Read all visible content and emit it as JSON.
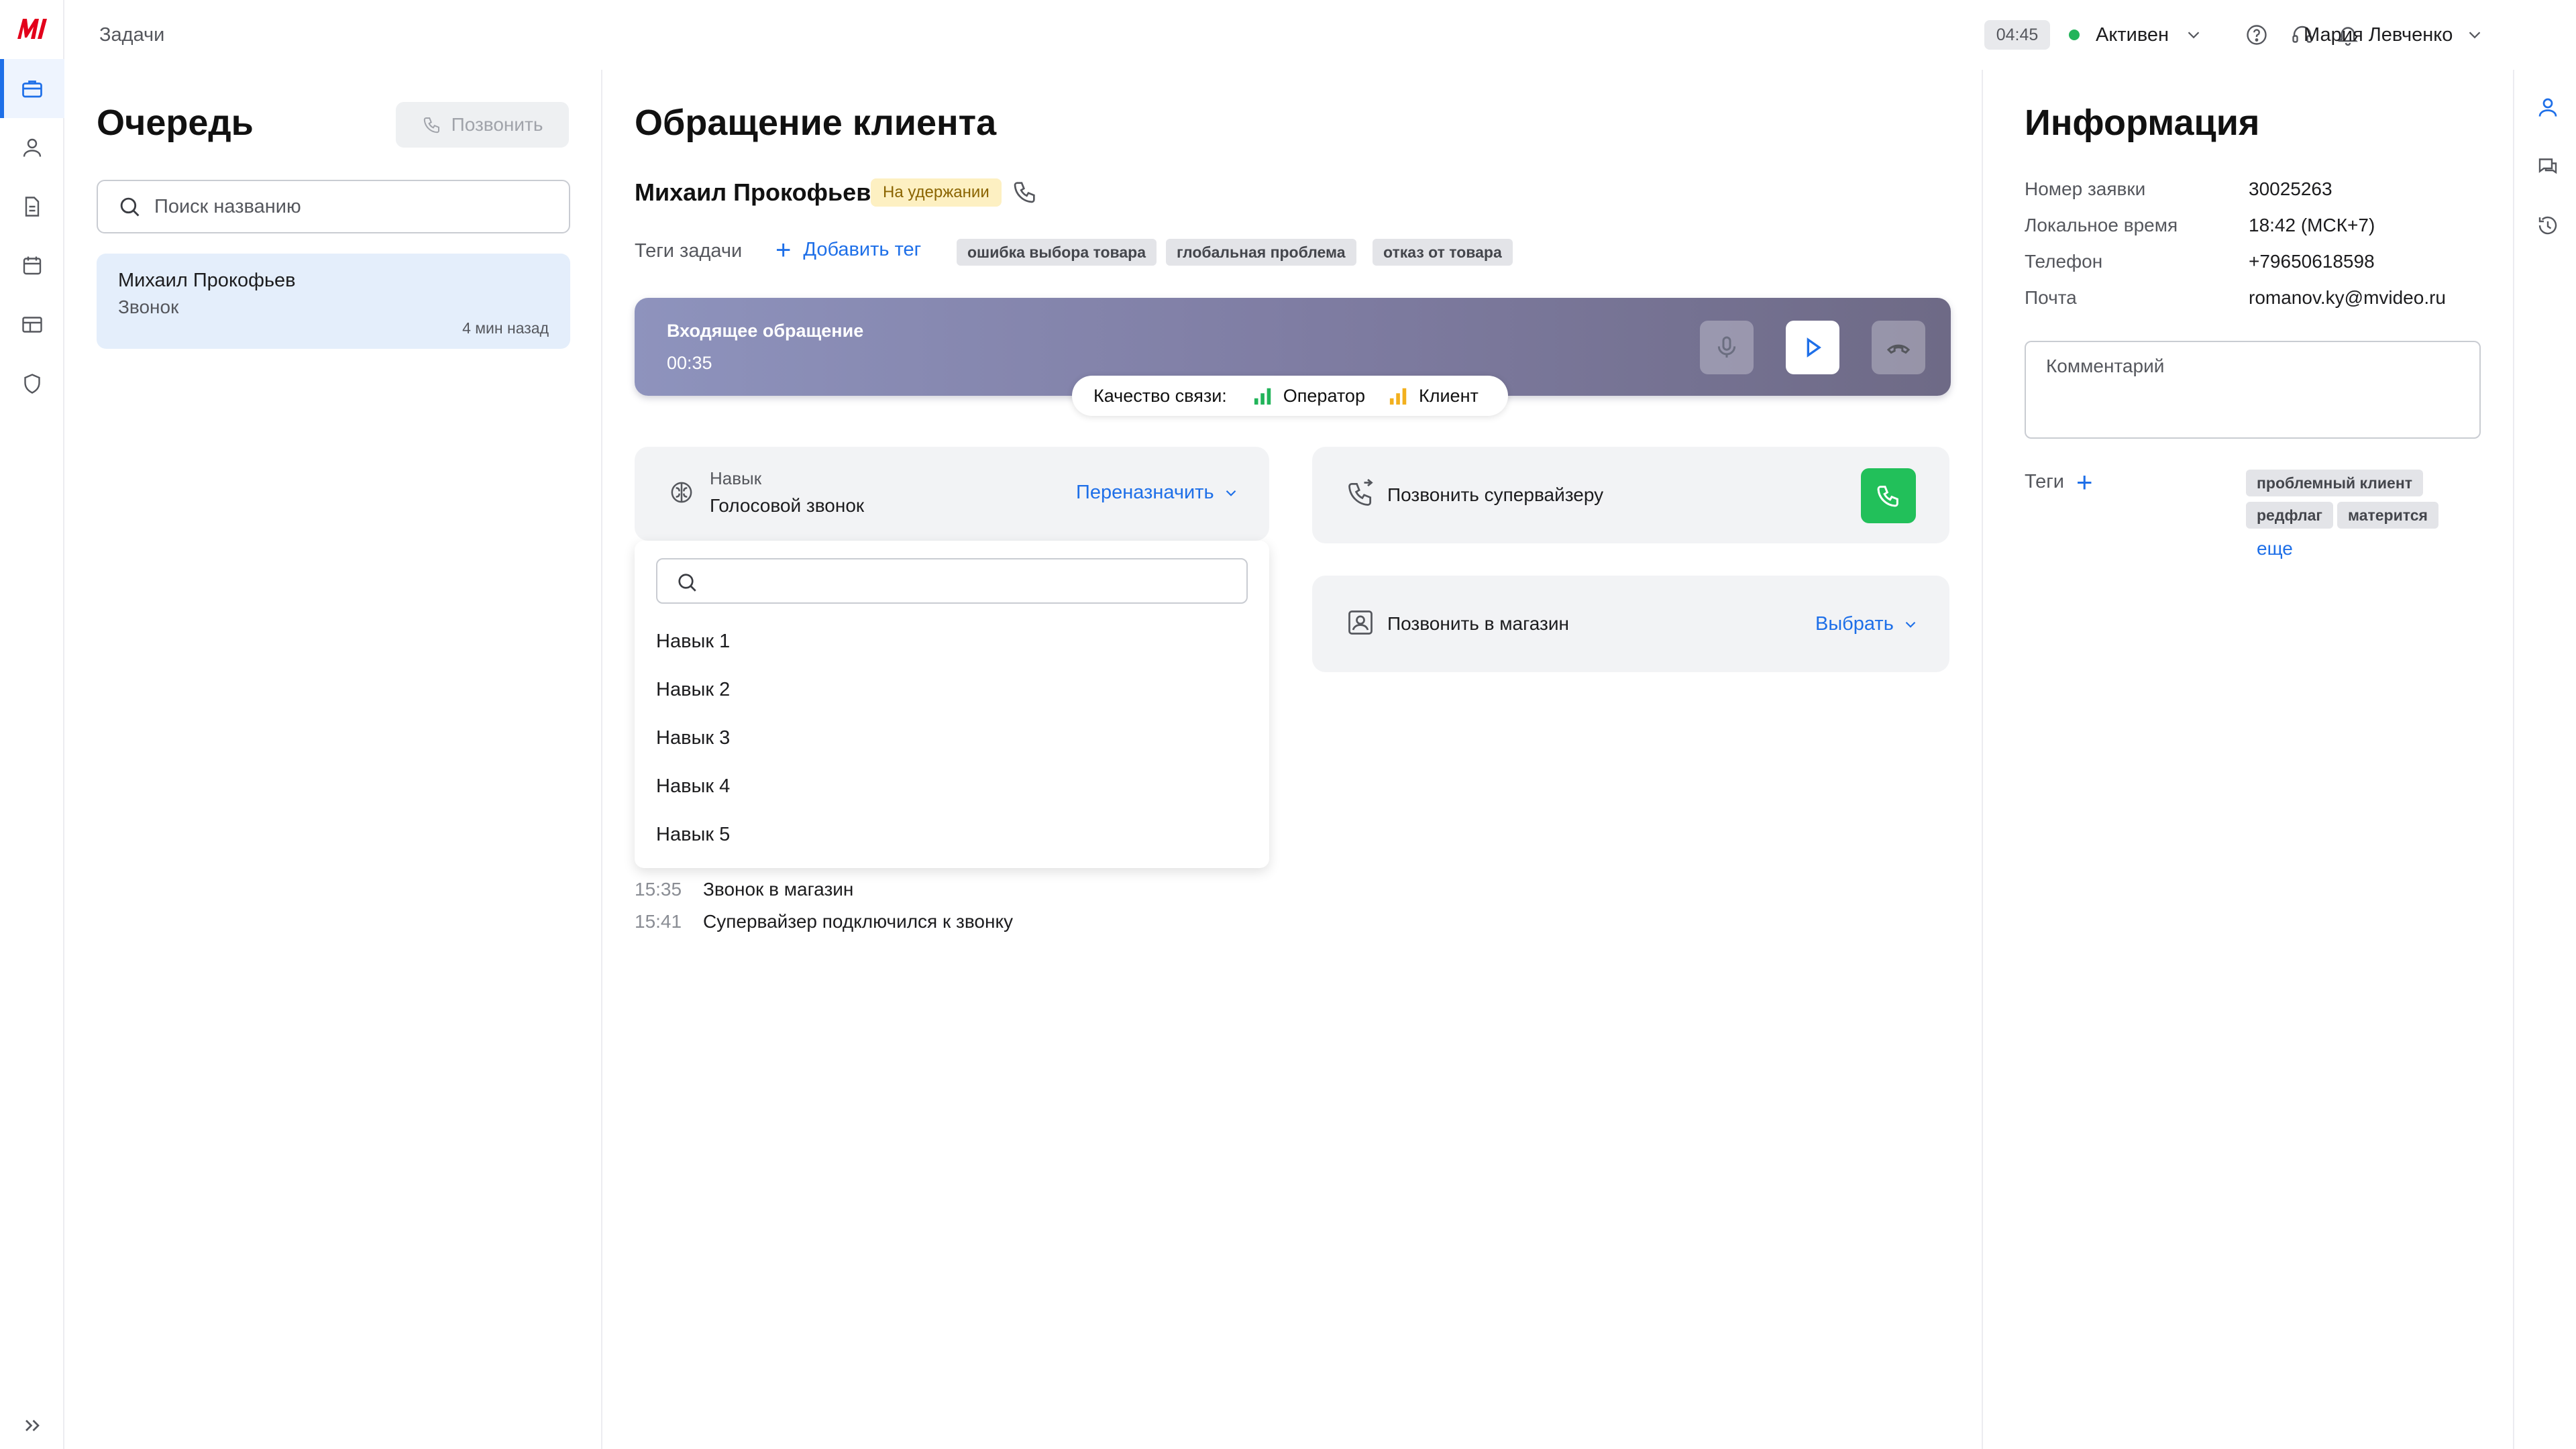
{
  "topbar": {
    "breadcrumb": "Задачи",
    "timer": "04:45",
    "status": "Активен",
    "user_name": "Мария Левченко"
  },
  "queue": {
    "title": "Очередь",
    "call_button": "Позвонить",
    "search_placeholder": "Поиск названию",
    "items": [
      {
        "name": "Михаил Прокофьев",
        "type": "Звонок",
        "time_ago": "4 мин назад"
      }
    ]
  },
  "request": {
    "title": "Обращение клиента",
    "client_name": "Михаил Прокофьев",
    "status_badge": "На удержании",
    "tags_label": "Теги задачи",
    "add_tag": "Добавить тег",
    "tags": [
      "ошибка выбора товара",
      "глобальная проблема",
      "отказ от товара"
    ],
    "call": {
      "title": "Входящее обращение",
      "duration": "00:35",
      "quality_label": "Качество связи:",
      "operator_label": "Оператор",
      "client_label": "Клиент",
      "operator_color": "#22b45a",
      "client_color": "#f2b01e"
    },
    "skill": {
      "label": "Навык",
      "value": "Голосовой звонок",
      "reassign": "Переназначить",
      "options": [
        "Навык 1",
        "Навык 2",
        "Навык 3",
        "Навык 4",
        "Навык 5"
      ]
    },
    "supervisor": {
      "label": "Позвонить супервайзеру"
    },
    "store": {
      "label": "Позвонить в магазин",
      "choose": "Выбрать"
    },
    "log": [
      {
        "time": "15:35",
        "text": "Звонок в магазин"
      },
      {
        "time": "15:41",
        "text": "Супервайзер подключился к звонку"
      }
    ]
  },
  "info": {
    "title": "Информация",
    "rows": [
      {
        "key": "Номер заявки",
        "value": "30025263"
      },
      {
        "key": "Локальное время",
        "value": "18:42 (МСК+7)"
      },
      {
        "key": "Телефон",
        "value": "+79650618598"
      },
      {
        "key": "Почта",
        "value": "romanov.ky@mvideo.ru"
      }
    ],
    "comment_placeholder": "Комментарий",
    "tags_label": "Теги",
    "tags": [
      "проблемный клиент",
      "редфлаг",
      "матерится"
    ],
    "more": "еще"
  },
  "icons": {
    "brand": "mvideo-logo",
    "accent": "#1e6fe8"
  }
}
